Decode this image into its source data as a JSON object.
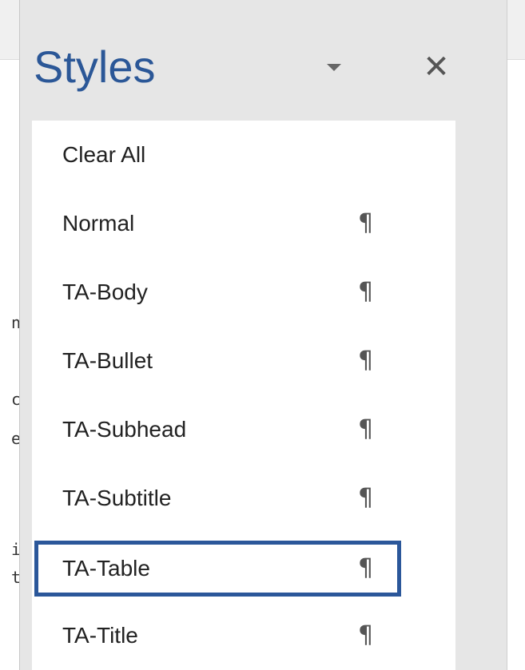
{
  "pane": {
    "title": "Styles",
    "menu_icon": "chevron-down-icon",
    "close_label": "✕"
  },
  "styles": [
    {
      "label": "Clear All",
      "mark": ""
    },
    {
      "label": "Normal",
      "mark": "¶"
    },
    {
      "label": "TA-Body",
      "mark": "¶"
    },
    {
      "label": "TA-Bullet",
      "mark": "¶"
    },
    {
      "label": "TA-Subhead",
      "mark": "¶"
    },
    {
      "label": "TA-Subtitle",
      "mark": "¶"
    },
    {
      "label": "TA-Table",
      "mark": "¶",
      "selected": true
    },
    {
      "label": "TA-Title",
      "mark": "¶"
    }
  ],
  "document_fragments": [
    "n",
    "c",
    "e",
    "i",
    "t"
  ],
  "colors": {
    "title": "#2b5797",
    "selection_border": "#2b579a",
    "pane_background": "#e6e6e6",
    "list_background": "#ffffff"
  }
}
